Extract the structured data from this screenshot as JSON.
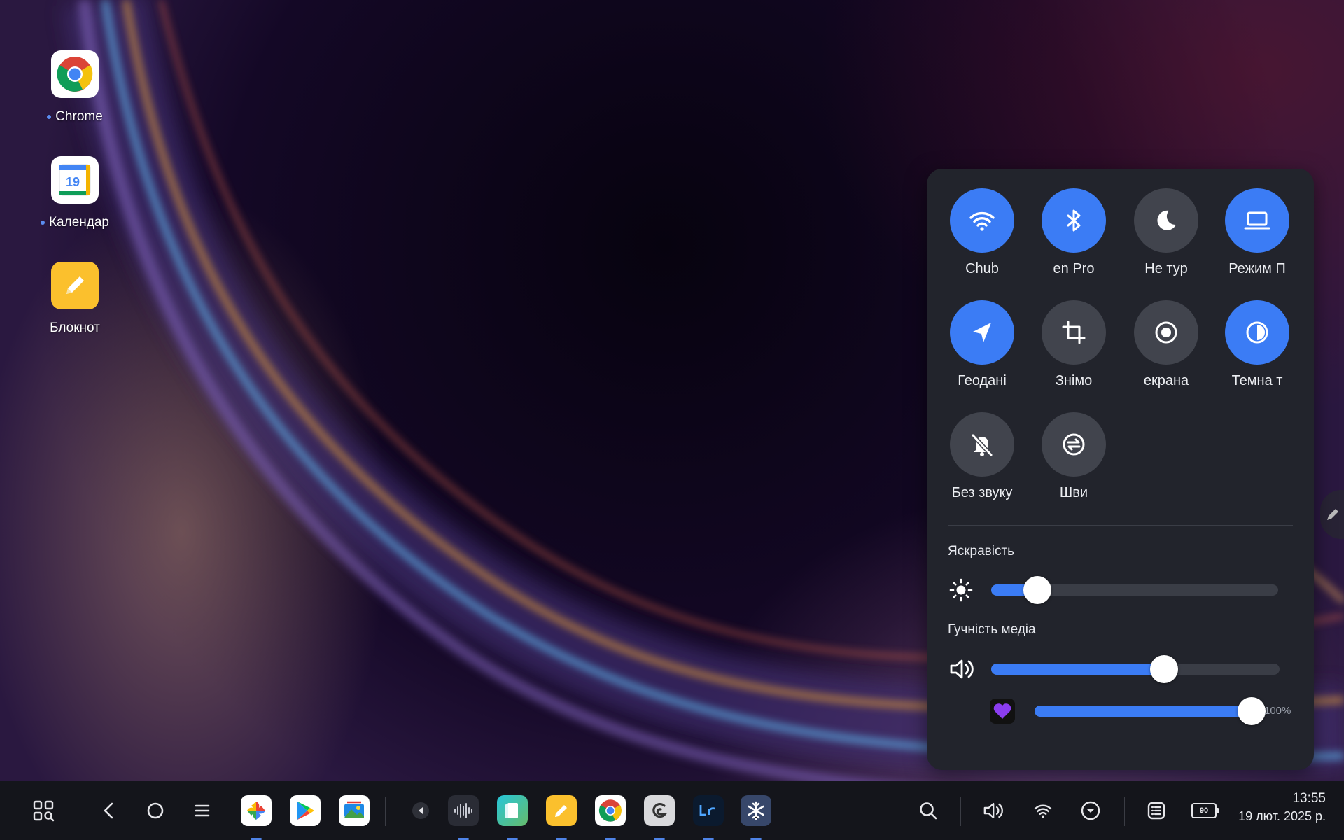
{
  "desktop": {
    "icons": [
      {
        "label": "Chrome",
        "running": true
      },
      {
        "label": "Календар",
        "running": true,
        "calendar_day": "19"
      },
      {
        "label": "Блокнот",
        "running": false
      }
    ]
  },
  "quick_settings": {
    "tiles": [
      {
        "label": "Chub",
        "icon": "wifi-icon",
        "on": true
      },
      {
        "label": "en Pro",
        "icon": "bluetooth-icon",
        "on": true
      },
      {
        "label": "Не тур",
        "icon": "moon-icon",
        "on": false
      },
      {
        "label": "Режим П",
        "icon": "laptop-icon",
        "on": true
      },
      {
        "label": "Геодані",
        "icon": "location-arrow-icon",
        "on": true
      },
      {
        "label": "Знімо",
        "icon": "crop-icon",
        "on": false
      },
      {
        "label": "екрана",
        "icon": "record-icon",
        "on": false
      },
      {
        "label": "Темна т",
        "icon": "contrast-icon",
        "on": true
      },
      {
        "label": "Без звуку",
        "icon": "bell-off-icon",
        "on": false
      },
      {
        "label": "Шви",
        "icon": "sync-icon",
        "on": false
      }
    ],
    "brightness": {
      "label": "Яскравість",
      "level": 0.16
    },
    "media_volume": {
      "label": "Гучність медіа",
      "level": 0.6
    },
    "app_volume": {
      "level": 1.0,
      "percent_text": "100%"
    }
  },
  "taskbar": {
    "clock_time": "13:55",
    "clock_date": "19 лют. 2025 р.",
    "battery": "90",
    "pinned_apps": [
      "photos",
      "play-store",
      "gallery",
      "voice-recorder",
      "books",
      "notes",
      "chrome",
      "clip-studio",
      "lightroom",
      "snowflake-app"
    ]
  },
  "colors": {
    "accent": "#3b7cf5",
    "panel": "#22242c",
    "tile_off": "#41444d"
  }
}
